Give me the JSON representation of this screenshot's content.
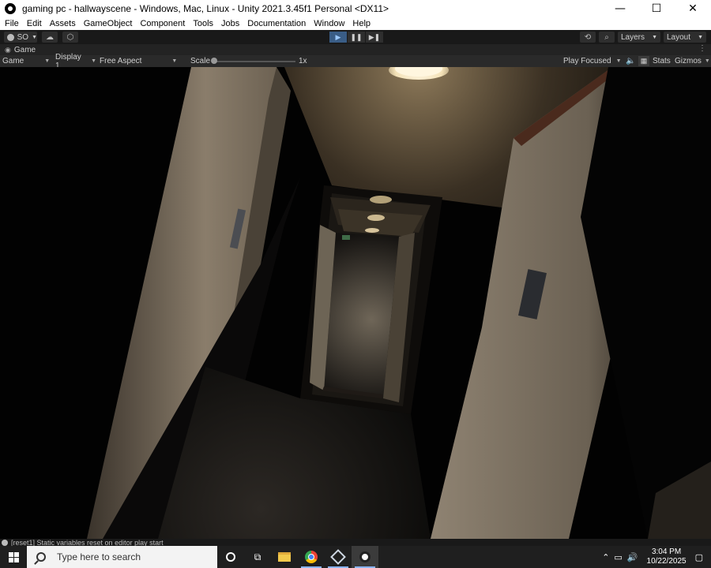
{
  "window": {
    "title": "gaming pc - hallwayscene - Windows, Mac, Linux - Unity 2021.3.45f1 Personal <DX11>",
    "minimize": "—",
    "maximize": "☐",
    "close": "✕"
  },
  "menu": [
    "File",
    "Edit",
    "Assets",
    "GameObject",
    "Component",
    "Tools",
    "Jobs",
    "Documentation",
    "Window",
    "Help"
  ],
  "toolbar": {
    "account_label": "SO",
    "layers_label": "Layers",
    "layout_label": "Layout",
    "play_state": "playing"
  },
  "game_tab": {
    "label": "Game"
  },
  "game_controls": {
    "view_select": "Game",
    "display_select": "Display 1",
    "aspect_select": "Free Aspect",
    "scale_label": "Scale",
    "scale_value": "1x",
    "play_mode": "Play Focused",
    "stats_label": "Stats",
    "gizmos_label": "Gizmos"
  },
  "status": {
    "message": "[reset1] Static variables reset on editor play start"
  },
  "taskbar": {
    "search_placeholder": "Type here to search",
    "time": "3:04 PM",
    "date": "10/22/2025"
  },
  "colors": {
    "play_active": "#3a5d86",
    "editor_dark": "#191919",
    "taskbar": "#1f1f1f"
  }
}
